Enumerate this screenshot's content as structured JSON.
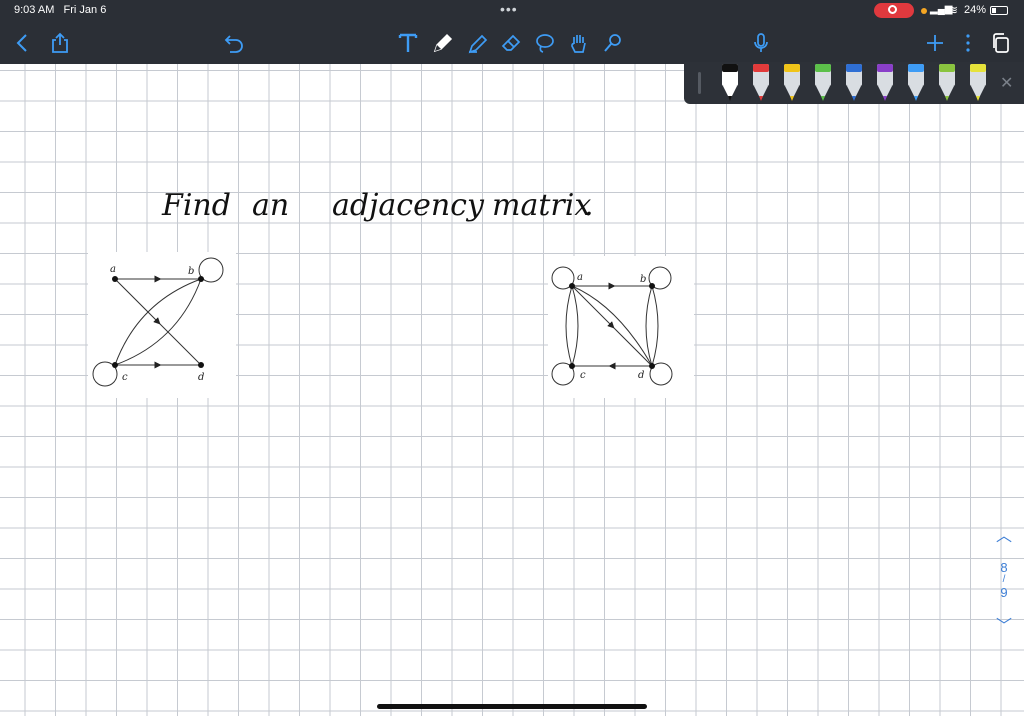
{
  "status": {
    "time": "9:03 AM",
    "date": "Fri Jan 6",
    "battery": "24%"
  },
  "toolbar": {
    "icons": [
      "back-icon",
      "share-icon",
      "undo-icon",
      "text-tool-icon",
      "pen-tool-icon",
      "highlighter-tool-icon",
      "eraser-tool-icon",
      "lasso-tool-icon",
      "hand-tool-icon",
      "laser-tool-icon",
      "microphone-icon",
      "add-icon",
      "more-icon",
      "pages-icon"
    ]
  },
  "pens": {
    "colors": [
      "#111111",
      "#e23b3b",
      "#f0c419",
      "#5cc04a",
      "#2f6fd4",
      "#8a3fc9",
      "#3e9cf5",
      "#8ac43f",
      "#e6e23a"
    ]
  },
  "note": {
    "w1": "Find",
    "w2": "an",
    "w3": "adjacency",
    "w4": "matrix",
    "w5": "."
  },
  "graph1": {
    "a": "a",
    "b": "b",
    "c": "c",
    "d": "d"
  },
  "graph2": {
    "a": "a",
    "b": "b",
    "c": "c",
    "d": "d"
  },
  "pager": {
    "current": "8",
    "sep": "/",
    "total": "9"
  }
}
